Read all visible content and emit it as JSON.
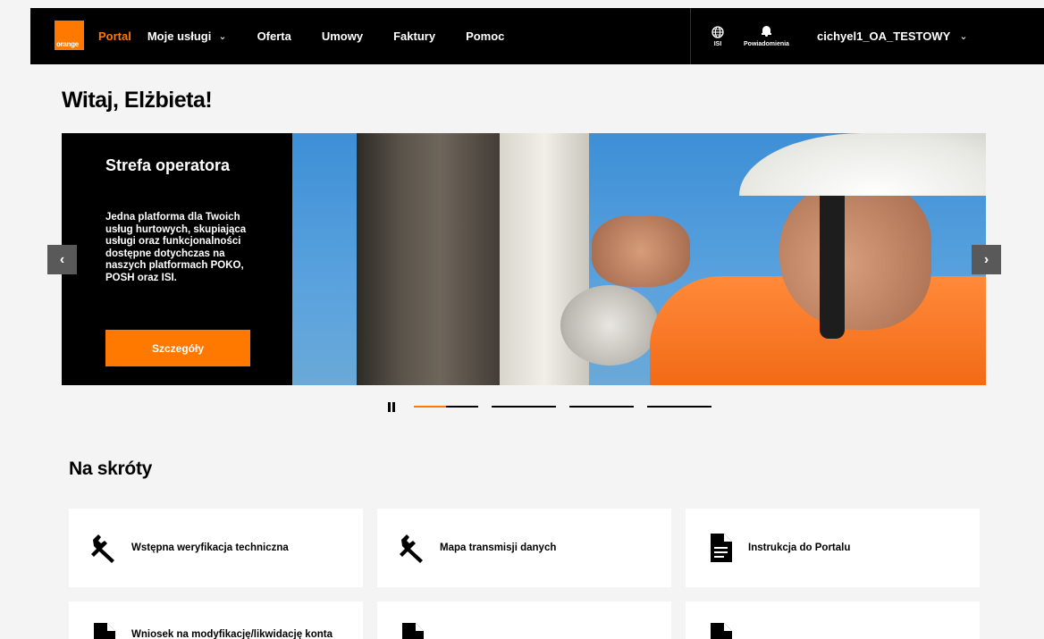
{
  "nav": {
    "logo_text": "orange",
    "items": [
      {
        "label": "Portal",
        "active": true
      },
      {
        "label": "Moje usługi",
        "has_dropdown": true
      },
      {
        "label": "Oferta"
      },
      {
        "label": "Umowy"
      },
      {
        "label": "Faktury"
      },
      {
        "label": "Pomoc"
      }
    ],
    "chevron": "⌄",
    "isi": {
      "label": "ISI",
      "icon": "globe-icon"
    },
    "notifications": {
      "label": "Powiadomienia",
      "icon": "bell-icon"
    },
    "user": "cichyel1_OA_TESTOWY"
  },
  "greeting": "Witaj, Elżbieta!",
  "hero": {
    "title": "Strefa operatora",
    "description": "Jedna platforma dla Twoich usług hurtowych, skupiająca usługi oraz funkcjonalności dostępne dotychczas na naszych platformach POKO, POSH oraz ISI.",
    "button": "Szczegóły",
    "prev": "‹",
    "next": "›",
    "slides_total": 4,
    "active_slide": 1,
    "active_progress": 0.5
  },
  "shortcuts": {
    "title": "Na skróty",
    "items": [
      {
        "label": "Wstępna weryfikacja techniczna",
        "icon": "wrench-icon"
      },
      {
        "label": "Mapa transmisji danych",
        "icon": "wrench-icon"
      },
      {
        "label": "Instrukcja do Portalu",
        "icon": "document-icon"
      },
      {
        "label": "Wniosek na modyfikację/likwidację konta",
        "icon": "document-icon"
      },
      {
        "label": "",
        "icon": "document-icon"
      },
      {
        "label": "",
        "icon": "document-icon"
      }
    ]
  },
  "colors": {
    "brand": "#ff7900",
    "topbar": "#000000",
    "background": "#f4f4f4"
  }
}
